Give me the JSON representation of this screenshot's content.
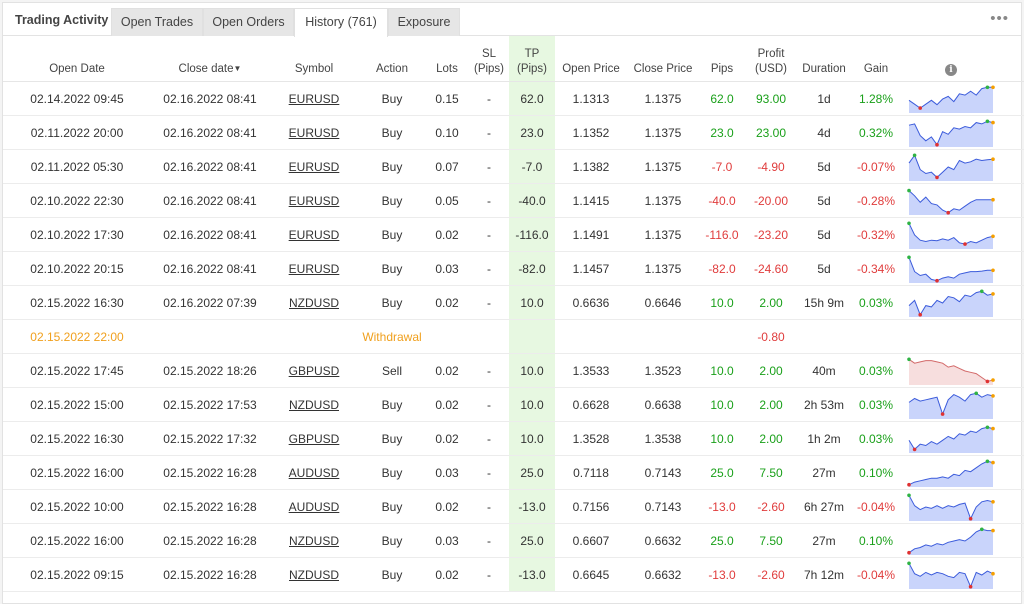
{
  "header": {
    "title": "Trading Activity",
    "tabs": [
      {
        "label": "Open Trades",
        "active": false
      },
      {
        "label": "Open Orders",
        "active": false
      },
      {
        "label": "History (761)",
        "active": true
      },
      {
        "label": "Exposure",
        "active": false
      }
    ],
    "menu_label": "•••"
  },
  "columns": {
    "open_date": "Open Date",
    "close_date": "Close date",
    "close_date_sort": "▼",
    "symbol": "Symbol",
    "action": "Action",
    "lots": "Lots",
    "sl_1": "SL",
    "sl_2": "(Pips)",
    "tp_1": "TP",
    "tp_2": "(Pips)",
    "open_price": "Open Price",
    "close_price": "Close Price",
    "pips": "Pips",
    "profit_1": "Profit",
    "profit_2": "(USD)",
    "duration": "Duration",
    "gain": "Gain",
    "info": "i"
  },
  "colors": {
    "positive": "#1aa01a",
    "negative": "#e03c3c",
    "withdrawal": "#f0a01e",
    "tp_bg": "#e7f8e1",
    "spark_line": "#3b5bdb",
    "spark_fill": "#c9d4fb",
    "spark_line_sell": "#d36a6a",
    "spark_fill_sell": "#f7dede"
  },
  "rows": [
    {
      "type": "trade",
      "open": "02.14.2022 09:45",
      "close": "02.16.2022 08:41",
      "symbol": "EURUSD",
      "action": "Buy",
      "lots": "0.15",
      "sl": "-",
      "tp": "62.0",
      "open_price": "1.1313",
      "close_price": "1.1375",
      "pips": "62.0",
      "profit": "93.00",
      "duration": "1d",
      "gain": "1.28%",
      "sign": "pos",
      "spark": [
        0.55,
        0.7,
        0.85,
        0.7,
        0.55,
        0.72,
        0.5,
        0.4,
        0.6,
        0.3,
        0.35,
        0.2,
        0.35,
        0.1,
        0.05,
        0.05
      ],
      "icon": "comment-icon"
    },
    {
      "type": "trade",
      "open": "02.11.2022 20:00",
      "close": "02.16.2022 08:41",
      "symbol": "EURUSD",
      "action": "Buy",
      "lots": "0.10",
      "sl": "-",
      "tp": "23.0",
      "open_price": "1.1352",
      "close_price": "1.1375",
      "pips": "23.0",
      "profit": "23.00",
      "duration": "4d",
      "gain": "0.32%",
      "sign": "pos",
      "spark": [
        0.2,
        0.15,
        0.6,
        0.8,
        0.65,
        0.95,
        0.45,
        0.55,
        0.3,
        0.35,
        0.25,
        0.3,
        0.1,
        0.15,
        0.05,
        0.1
      ],
      "icon": "comment-icon"
    },
    {
      "type": "trade",
      "open": "02.11.2022 05:30",
      "close": "02.16.2022 08:41",
      "symbol": "EURUSD",
      "action": "Buy",
      "lots": "0.07",
      "sl": "-",
      "tp": "-7.0",
      "open_price": "1.1382",
      "close_price": "1.1375",
      "pips": "-7.0",
      "profit": "-4.90",
      "duration": "5d",
      "gain": "-0.07%",
      "sign": "neg",
      "spark": [
        0.35,
        0.05,
        0.6,
        0.75,
        0.7,
        0.9,
        0.7,
        0.5,
        0.6,
        0.25,
        0.35,
        0.3,
        0.2,
        0.25,
        0.22,
        0.2
      ],
      "icon": "comment-icon"
    },
    {
      "type": "trade",
      "open": "02.10.2022 22:30",
      "close": "02.16.2022 08:41",
      "symbol": "EURUSD",
      "action": "Buy",
      "lots": "0.05",
      "sl": "-",
      "tp": "-40.0",
      "open_price": "1.1415",
      "close_price": "1.1375",
      "pips": "-40.0",
      "profit": "-20.00",
      "duration": "5d",
      "gain": "-0.28%",
      "sign": "neg",
      "spark": [
        0.1,
        0.3,
        0.55,
        0.35,
        0.6,
        0.65,
        0.85,
        0.95,
        0.8,
        0.85,
        0.7,
        0.55,
        0.45,
        0.45,
        0.45,
        0.45
      ],
      "icon": "comment-icon"
    },
    {
      "type": "trade",
      "open": "02.10.2022 17:30",
      "close": "02.16.2022 08:41",
      "symbol": "EURUSD",
      "action": "Buy",
      "lots": "0.02",
      "sl": "-",
      "tp": "-116.0",
      "open_price": "1.1491",
      "close_price": "1.1375",
      "pips": "-116.0",
      "profit": "-23.20",
      "duration": "5d",
      "gain": "-0.32%",
      "sign": "neg",
      "spark": [
        0.05,
        0.5,
        0.7,
        0.75,
        0.7,
        0.72,
        0.65,
        0.7,
        0.6,
        0.8,
        0.85,
        0.75,
        0.8,
        0.7,
        0.6,
        0.55
      ],
      "icon": "comment-icon"
    },
    {
      "type": "trade",
      "open": "02.10.2022 20:15",
      "close": "02.16.2022 08:41",
      "symbol": "EURUSD",
      "action": "Buy",
      "lots": "0.03",
      "sl": "-",
      "tp": "-82.0",
      "open_price": "1.1457",
      "close_price": "1.1375",
      "pips": "-82.0",
      "profit": "-24.60",
      "duration": "5d",
      "gain": "-0.34%",
      "sign": "neg",
      "spark": [
        0.05,
        0.6,
        0.75,
        0.7,
        0.9,
        0.95,
        0.85,
        0.8,
        0.85,
        0.7,
        0.65,
        0.6,
        0.6,
        0.58,
        0.55,
        0.55
      ],
      "icon": "comment-icon"
    },
    {
      "type": "trade",
      "open": "02.15.2022 16:30",
      "close": "02.16.2022 07:39",
      "symbol": "NZDUSD",
      "action": "Buy",
      "lots": "0.02",
      "sl": "-",
      "tp": "10.0",
      "open_price": "0.6636",
      "close_price": "0.6646",
      "pips": "10.0",
      "profit": "2.00",
      "duration": "15h 9m",
      "gain": "0.03%",
      "sign": "pos",
      "spark": [
        0.6,
        0.4,
        0.95,
        0.6,
        0.65,
        0.4,
        0.5,
        0.25,
        0.3,
        0.45,
        0.2,
        0.25,
        0.1,
        0.05,
        0.2,
        0.15
      ],
      "icon": "comment-icon"
    },
    {
      "type": "withdrawal",
      "open": "02.15.2022 22:00",
      "label": "Withdrawal",
      "profit": "-0.80",
      "icon": "comment-icon"
    },
    {
      "type": "trade",
      "open": "02.15.2022 17:45",
      "close": "02.15.2022 18:26",
      "symbol": "GBPUSD",
      "action": "Sell",
      "lots": "0.02",
      "sl": "-",
      "tp": "10.0",
      "open_price": "1.3533",
      "close_price": "1.3523",
      "pips": "10.0",
      "profit": "2.00",
      "duration": "40m",
      "gain": "0.03%",
      "sign": "pos",
      "sell": true,
      "spark": [
        0.05,
        0.2,
        0.15,
        0.1,
        0.1,
        0.15,
        0.2,
        0.35,
        0.3,
        0.4,
        0.5,
        0.55,
        0.6,
        0.75,
        0.9,
        0.85
      ],
      "icon": "comment-icon"
    },
    {
      "type": "trade",
      "open": "02.15.2022 15:00",
      "close": "02.15.2022 17:53",
      "symbol": "NZDUSD",
      "action": "Buy",
      "lots": "0.02",
      "sl": "-",
      "tp": "10.0",
      "open_price": "0.6628",
      "close_price": "0.6638",
      "pips": "10.0",
      "profit": "2.00",
      "duration": "2h 53m",
      "gain": "0.03%",
      "sign": "pos",
      "spark": [
        0.4,
        0.25,
        0.35,
        0.3,
        0.25,
        0.2,
        0.85,
        0.3,
        0.1,
        0.2,
        0.35,
        0.1,
        0.05,
        0.2,
        0.1,
        0.15
      ],
      "icon": "comment-icon"
    },
    {
      "type": "trade",
      "open": "02.15.2022 16:30",
      "close": "02.15.2022 17:32",
      "symbol": "GBPUSD",
      "action": "Buy",
      "lots": "0.02",
      "sl": "-",
      "tp": "10.0",
      "open_price": "1.3528",
      "close_price": "1.3538",
      "pips": "10.0",
      "profit": "2.00",
      "duration": "1h 2m",
      "gain": "0.03%",
      "sign": "pos",
      "spark": [
        0.55,
        0.9,
        0.7,
        0.75,
        0.6,
        0.7,
        0.55,
        0.4,
        0.5,
        0.3,
        0.35,
        0.2,
        0.25,
        0.1,
        0.05,
        0.1
      ],
      "icon": "comment-icon"
    },
    {
      "type": "trade",
      "open": "02.15.2022 16:00",
      "close": "02.15.2022 16:28",
      "symbol": "AUDUSD",
      "action": "Buy",
      "lots": "0.03",
      "sl": "-",
      "tp": "25.0",
      "open_price": "0.7118",
      "close_price": "0.7143",
      "pips": "25.0",
      "profit": "7.50",
      "duration": "27m",
      "gain": "0.10%",
      "sign": "pos",
      "spark": [
        0.95,
        0.85,
        0.8,
        0.75,
        0.7,
        0.7,
        0.65,
        0.7,
        0.55,
        0.6,
        0.4,
        0.45,
        0.3,
        0.15,
        0.05,
        0.1
      ],
      "icon": "comment-icon"
    },
    {
      "type": "trade",
      "open": "02.15.2022 10:00",
      "close": "02.15.2022 16:28",
      "symbol": "AUDUSD",
      "action": "Buy",
      "lots": "0.02",
      "sl": "-",
      "tp": "-13.0",
      "open_price": "0.7156",
      "close_price": "0.7143",
      "pips": "-13.0",
      "profit": "-2.60",
      "duration": "6h 27m",
      "gain": "-0.04%",
      "sign": "neg",
      "spark": [
        0.05,
        0.45,
        0.6,
        0.5,
        0.55,
        0.45,
        0.55,
        0.45,
        0.5,
        0.4,
        0.35,
        0.95,
        0.5,
        0.3,
        0.25,
        0.3
      ],
      "icon": "comment-icon"
    },
    {
      "type": "trade",
      "open": "02.15.2022 16:00",
      "close": "02.15.2022 16:28",
      "symbol": "NZDUSD",
      "action": "Buy",
      "lots": "0.03",
      "sl": "-",
      "tp": "25.0",
      "open_price": "0.6607",
      "close_price": "0.6632",
      "pips": "25.0",
      "profit": "7.50",
      "duration": "27m",
      "gain": "0.10%",
      "sign": "pos",
      "spark": [
        0.95,
        0.8,
        0.75,
        0.65,
        0.7,
        0.6,
        0.65,
        0.55,
        0.5,
        0.45,
        0.5,
        0.35,
        0.15,
        0.05,
        0.1,
        0.1
      ],
      "icon": "comment-icon"
    },
    {
      "type": "trade",
      "open": "02.15.2022 09:15",
      "close": "02.15.2022 16:28",
      "symbol": "NZDUSD",
      "action": "Buy",
      "lots": "0.02",
      "sl": "-",
      "tp": "-13.0",
      "open_price": "0.6645",
      "close_price": "0.6632",
      "pips": "-13.0",
      "profit": "-2.60",
      "duration": "7h 12m",
      "gain": "-0.04%",
      "sign": "neg",
      "spark": [
        0.05,
        0.45,
        0.55,
        0.4,
        0.5,
        0.4,
        0.45,
        0.55,
        0.6,
        0.4,
        0.45,
        0.95,
        0.4,
        0.5,
        0.35,
        0.45
      ],
      "icon": "comment-icon"
    }
  ]
}
